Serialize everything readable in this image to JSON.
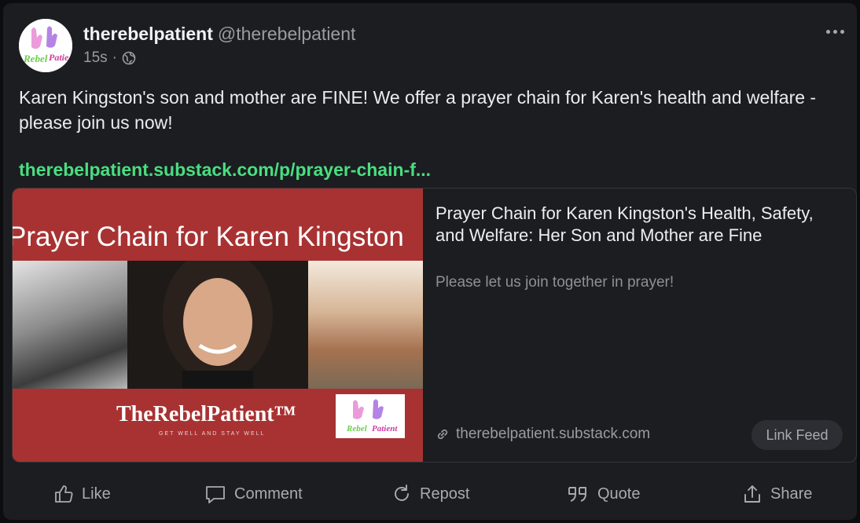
{
  "post": {
    "author_name": "therebelpatient",
    "author_handle": "@therebelpatient",
    "timestamp": "15s",
    "separator": "·",
    "visibility_icon": "globe-icon",
    "body": "Karen Kingston's son and mother are FINE! We offer a prayer chain for Karen's health and welfare - please join us now!",
    "link": "therebelpatient.substack.com/p/prayer-chain-f..."
  },
  "avatar": {
    "logo_text": "Rebel Patient"
  },
  "preview": {
    "image_title": "Prayer Chain for Karen Kingston",
    "image_brand": "TheRebelPatient™",
    "image_tagline": "GET WELL AND STAY WELL",
    "image_logo_text": "Rebel Patient",
    "title": "Prayer Chain for Karen Kingston's Health, Safety, and Welfare: Her Son and Mother are Fine",
    "description": "Please let us join together in prayer!",
    "domain": "therebelpatient.substack.com",
    "button_label": "Link Feed"
  },
  "actions": {
    "like": "Like",
    "comment": "Comment",
    "repost": "Repost",
    "quote": "Quote",
    "share": "Share"
  },
  "colors": {
    "card_bg": "#1b1d21",
    "link_green": "#4ade80",
    "thumb_red": "#a83232"
  }
}
